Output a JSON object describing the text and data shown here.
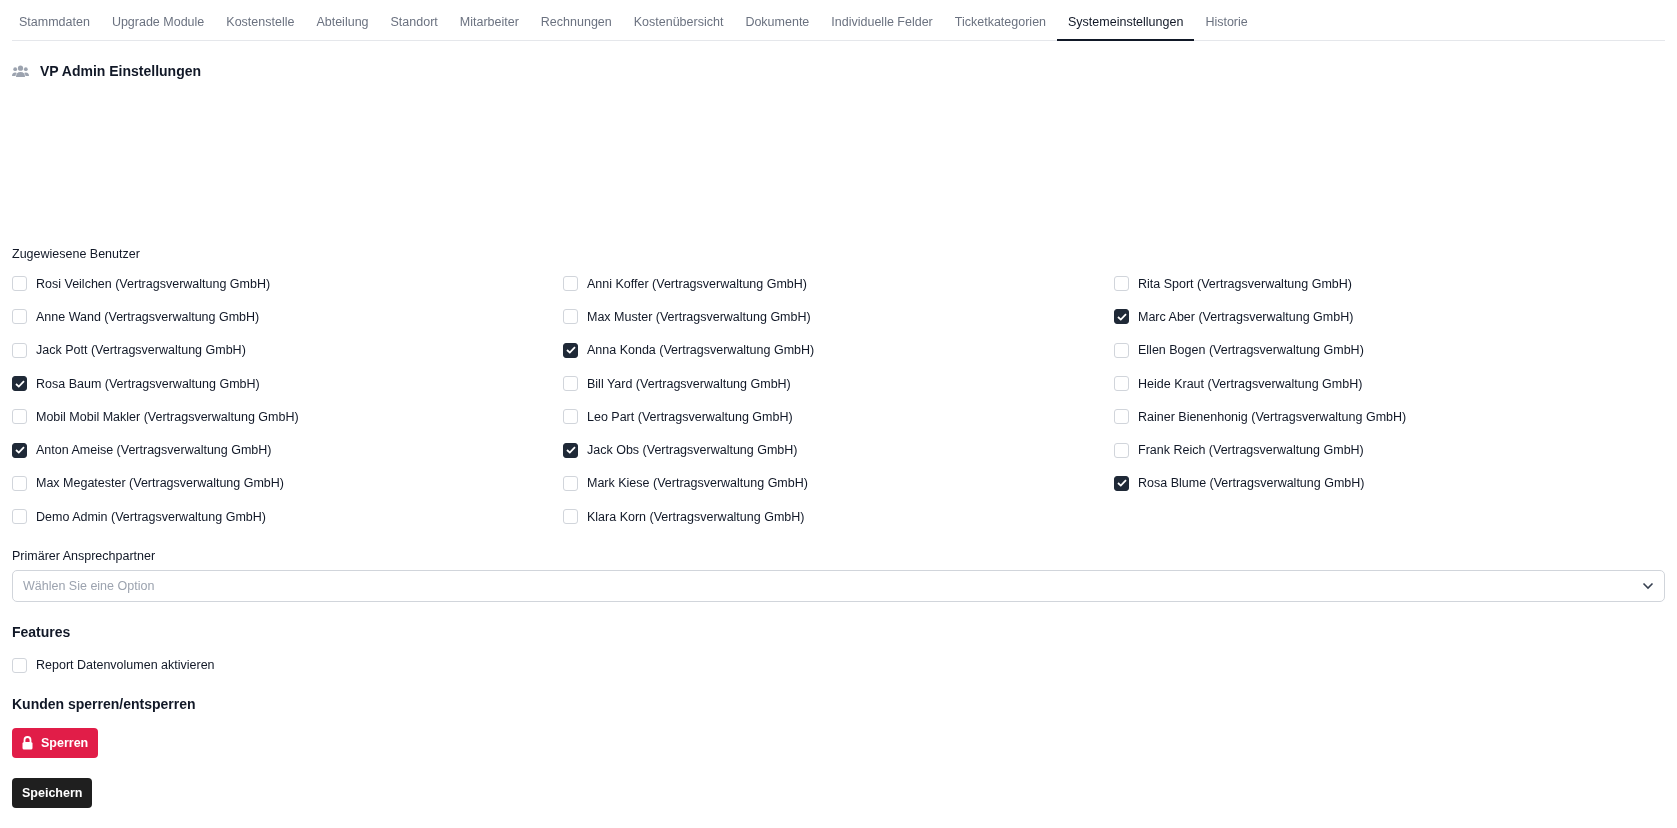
{
  "tabs": [
    {
      "label": "Stammdaten",
      "selected": false
    },
    {
      "label": "Upgrade Module",
      "selected": false
    },
    {
      "label": "Kostenstelle",
      "selected": false
    },
    {
      "label": "Abteilung",
      "selected": false
    },
    {
      "label": "Standort",
      "selected": false
    },
    {
      "label": "Mitarbeiter",
      "selected": false
    },
    {
      "label": "Rechnungen",
      "selected": false
    },
    {
      "label": "Kostenübersicht",
      "selected": false
    },
    {
      "label": "Dokumente",
      "selected": false
    },
    {
      "label": "Individuelle Felder",
      "selected": false
    },
    {
      "label": "Ticketkategorien",
      "selected": false
    },
    {
      "label": "Systemeinstellungen",
      "selected": true
    },
    {
      "label": "Historie",
      "selected": false
    }
  ],
  "section_title": "VP Admin Einstellungen",
  "assigned_users": {
    "label": "Zugewiesene Benutzer",
    "columns": [
      [
        {
          "label": "Rosi Veilchen (Vertragsverwaltung GmbH)",
          "checked": false
        },
        {
          "label": "Anne Wand (Vertragsverwaltung GmbH)",
          "checked": false
        },
        {
          "label": "Jack Pott (Vertragsverwaltung GmbH)",
          "checked": false
        },
        {
          "label": "Rosa Baum (Vertragsverwaltung GmbH)",
          "checked": true
        },
        {
          "label": "Mobil Mobil Makler (Vertragsverwaltung GmbH)",
          "checked": false
        },
        {
          "label": "Anton Ameise (Vertragsverwaltung GmbH)",
          "checked": true
        },
        {
          "label": "Max Megatester (Vertragsverwaltung GmbH)",
          "checked": false
        },
        {
          "label": "Demo Admin (Vertragsverwaltung GmbH)",
          "checked": false
        }
      ],
      [
        {
          "label": "Anni Koffer (Vertragsverwaltung GmbH)",
          "checked": false
        },
        {
          "label": "Max Muster (Vertragsverwaltung GmbH)",
          "checked": false
        },
        {
          "label": "Anna Konda (Vertragsverwaltung GmbH)",
          "checked": true
        },
        {
          "label": "Bill Yard (Vertragsverwaltung GmbH)",
          "checked": false
        },
        {
          "label": "Leo Part (Vertragsverwaltung GmbH)",
          "checked": false
        },
        {
          "label": "Jack Obs (Vertragsverwaltung GmbH)",
          "checked": true
        },
        {
          "label": "Mark Kiese (Vertragsverwaltung GmbH)",
          "checked": false
        },
        {
          "label": "Klara Korn (Vertragsverwaltung GmbH)",
          "checked": false
        }
      ],
      [
        {
          "label": "Rita Sport (Vertragsverwaltung GmbH)",
          "checked": false
        },
        {
          "label": "Marc Aber (Vertragsverwaltung GmbH)",
          "checked": true
        },
        {
          "label": "Ellen Bogen (Vertragsverwaltung GmbH)",
          "checked": false
        },
        {
          "label": "Heide Kraut (Vertragsverwaltung GmbH)",
          "checked": false
        },
        {
          "label": "Rainer Bienenhonig (Vertragsverwaltung GmbH)",
          "checked": false
        },
        {
          "label": "Frank Reich (Vertragsverwaltung GmbH)",
          "checked": false
        },
        {
          "label": "Rosa Blume (Vertragsverwaltung GmbH)",
          "checked": true
        }
      ]
    ]
  },
  "primary_contact": {
    "label": "Primärer Ansprechpartner",
    "placeholder": "Wählen Sie eine Option"
  },
  "features": {
    "title": "Features",
    "options": [
      {
        "label": "Report Datenvolumen aktivieren",
        "checked": false
      }
    ]
  },
  "lock": {
    "title": "Kunden sperren/entsperren",
    "button": "Sperren"
  },
  "save_button": "Speichern"
}
